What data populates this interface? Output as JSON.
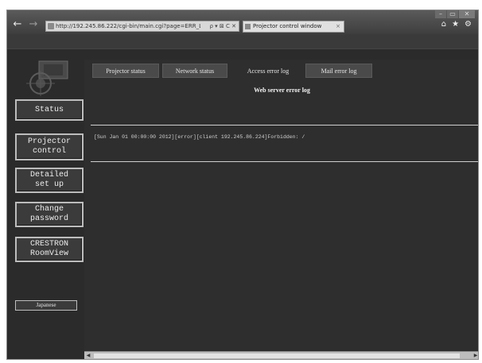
{
  "browser": {
    "url": "http://192.245.86.222/cgi-bin/main.cgi?page=ERR_LOG",
    "address_icons": "ρ ▾ ⊠ C ✕",
    "tab_title": "Projector control window",
    "tab_close": "×",
    "icons": [
      "back-icon",
      "forward-icon",
      "home-icon",
      "star-icon",
      "gear-icon"
    ]
  },
  "sidebar": {
    "items": [
      {
        "label": "Status"
      },
      {
        "label": "Projector\ncontrol"
      },
      {
        "label": "Detailed\nset up"
      },
      {
        "label": "Change\npassword"
      },
      {
        "label": "CRESTRON\nRoomView"
      }
    ],
    "logout": "Japanese"
  },
  "tabs": [
    {
      "label": "Projector status",
      "active": false
    },
    {
      "label": "Network status",
      "active": false
    },
    {
      "label": "Access error log",
      "active": true
    },
    {
      "label": "Mail error log",
      "active": false
    }
  ],
  "main": {
    "title": "Web server error log",
    "log_entries": [
      "[Sun Jan 01 00:00:00 2012][error][client 192.245.86.224]Forbidden: /"
    ]
  },
  "colors": {
    "background": "#2b2b2b",
    "panel": "#2e2e2e",
    "button_border": "#bdbdbd",
    "text": "#ededed"
  }
}
